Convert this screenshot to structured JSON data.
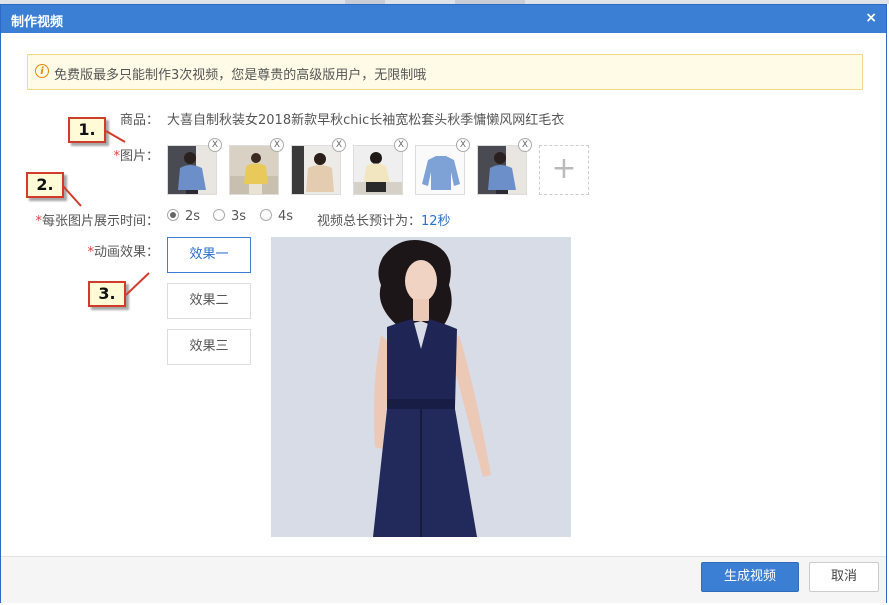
{
  "dialog": {
    "title": "制作视频",
    "close_glyph": "×"
  },
  "notice": {
    "icon": "info-icon",
    "icon_glyph": "i",
    "text": "免费版最多只能制作3次视频，您是尊贵的高级版用户，无限制哦"
  },
  "product": {
    "label": "商品：",
    "name": "大喜自制秋装女2018新款早秋chic长袖宽松套头秋季慵懒风网红毛衣"
  },
  "images": {
    "required_mark": "*",
    "label": "图片：",
    "remove_glyph": "X",
    "add_glyph": "+",
    "count": 6
  },
  "display_time": {
    "required_mark": "*",
    "label": "每张图片展示时间：",
    "options": [
      "2s",
      "3s",
      "4s"
    ],
    "selected": "2s",
    "total_label": "视频总长预计为：",
    "total_value": "12秒"
  },
  "animation": {
    "required_mark": "*",
    "label": "动画效果：",
    "effects": [
      "效果一",
      "效果二",
      "效果三"
    ],
    "selected": "效果一"
  },
  "callouts": [
    "1.",
    "2.",
    "3."
  ],
  "footer": {
    "generate": "生成视频",
    "cancel": "取消"
  },
  "colors": {
    "accent": "#3a7fd4",
    "required": "#e53935",
    "link": "#2a6fcc",
    "callout_border": "#d23b2a"
  }
}
